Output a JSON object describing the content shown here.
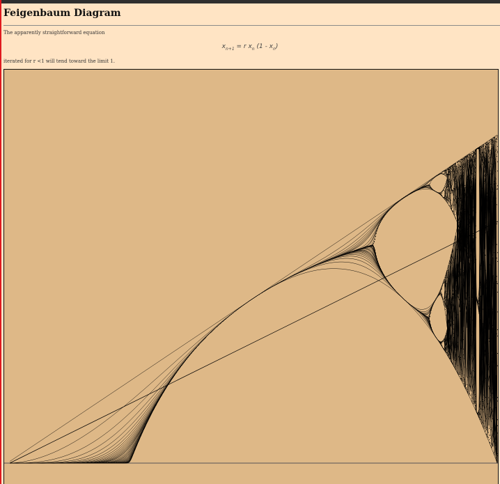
{
  "page": {
    "title": "Feigenbaum Diagram",
    "intro_text": "The apparently straightforward equation",
    "equation": {
      "lhs_var": "x",
      "lhs_sub": "n+1",
      "rhs_prefix": " = r x",
      "rhs_sub": "n",
      "rhs_mid": " (1 - x",
      "rhs_sub2": "n",
      "rhs_suffix": ")"
    },
    "note_text": "iterated for r <1 will tend toward the limit 1."
  },
  "colors": {
    "page_background": "#ffe4c4",
    "plot_background": "#deb887",
    "ink": "#000000",
    "top_bar": "#2f2f2f",
    "left_accent": "#e0191f"
  }
}
